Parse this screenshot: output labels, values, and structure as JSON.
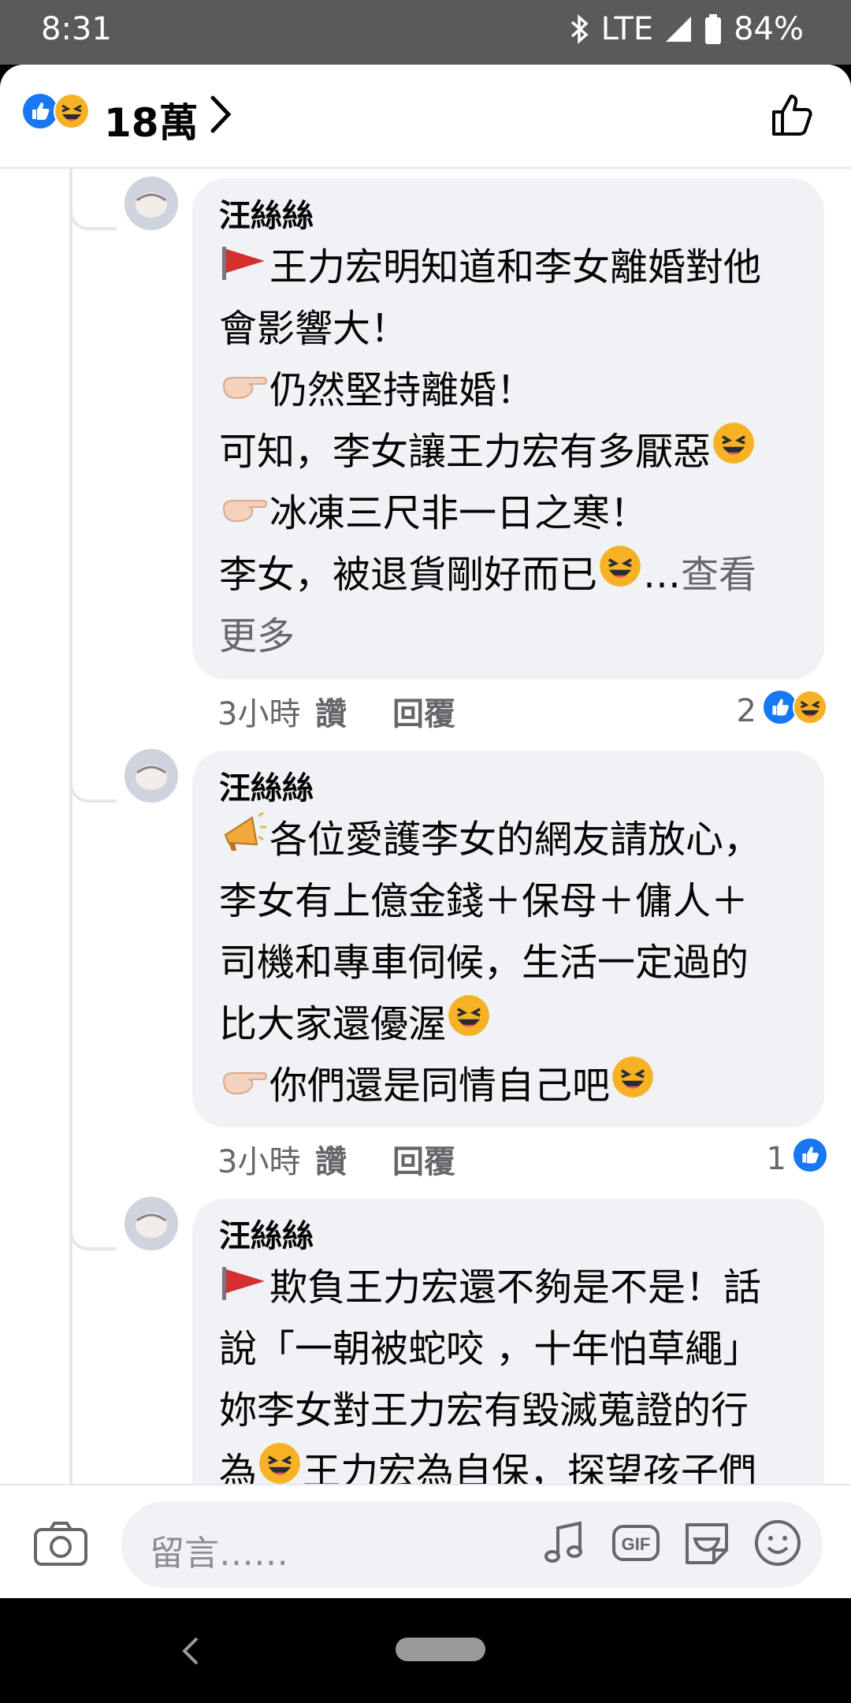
{
  "status_bar": {
    "time": "8:31",
    "network": "LTE",
    "battery": "84%"
  },
  "header": {
    "reaction_count": "18萬",
    "reaction_icons": [
      "like-icon",
      "haha-icon"
    ]
  },
  "comments": [
    {
      "author": "汪絲絲",
      "lines": [
        {
          "icon": "red-flag-icon",
          "text": "王力宏明知道和李女離婚對他"
        },
        {
          "text": "會影響大！"
        },
        {
          "icon": "pointing-hand-icon",
          "text": "仍然堅持離婚！"
        },
        {
          "text": "可知，李女讓王力宏有多厭惡",
          "trail_icon": "laughing-emoji-icon"
        },
        {
          "icon": "pointing-hand-icon",
          "text": "冰凍三尺非一日之寒！"
        },
        {
          "text": "李女，被退貨剛好而已",
          "trail_icon": "laughing-emoji-icon",
          "ellipsis": "…",
          "see_more": " 查看"
        },
        {
          "see_more_cont": "更多"
        }
      ],
      "time": "3小時",
      "like_label": "讚",
      "reply_label": "回覆",
      "reaction_count": "2",
      "reactions": [
        "like-icon",
        "haha-icon"
      ]
    },
    {
      "author": "汪絲絲",
      "lines": [
        {
          "icon": "megaphone-icon",
          "text": "各位愛護李女的網友請放心，"
        },
        {
          "text": "李女有上億金錢＋保母＋傭人＋"
        },
        {
          "text": "司機和專車伺候，生活一定過的"
        },
        {
          "text": "比大家還優渥",
          "trail_icon": "laughing-emoji-icon"
        },
        {
          "icon": "pointing-hand-icon",
          "text": "你們還是同情自己吧",
          "trail_icon": "laughing-emoji-icon"
        }
      ],
      "time": "3小時",
      "like_label": "讚",
      "reply_label": "回覆",
      "reaction_count": "1",
      "reactions": [
        "like-icon"
      ]
    },
    {
      "author": "汪絲絲",
      "lines": [
        {
          "icon": "red-flag-icon",
          "text": "欺負王力宏還不夠是不是！話"
        },
        {
          "text": "說「一朝被蛇咬 ，十年怕草繩」"
        },
        {
          "text": "妳李女對王力宏有毀滅蒐證的行"
        },
        {
          "text": "為",
          "mid_icon": "laughing-emoji-icon",
          "text2": "王力宏為自保，探望孩子們"
        }
      ]
    }
  ],
  "composer": {
    "placeholder": "留言……",
    "icons": [
      "camera-icon",
      "music-icon",
      "gif-icon",
      "sticker-icon",
      "emoji-icon"
    ]
  },
  "colors": {
    "accent": "#1877f2",
    "bubble": "#f0f2f5",
    "meta_text": "#65676b",
    "status_bar": "#5a5a5a"
  }
}
